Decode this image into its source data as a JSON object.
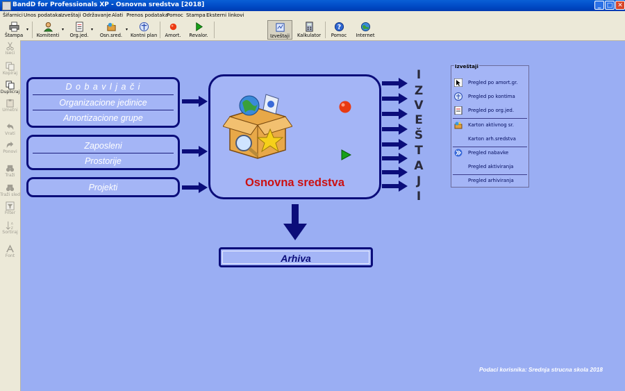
{
  "window": {
    "title": "BandD for Professionals XP - Osnovna sredstva [2018]"
  },
  "menu": [
    "Šifarnici",
    "Unos podataka",
    "Izveštaji",
    "Održavanje",
    "Alati",
    "Prenos podataka",
    "Pomoc",
    "Stampa",
    "Eksterni linkovi"
  ],
  "toolbar": {
    "stampa": "Štampa",
    "komitenti": "Komitenti",
    "orgjed": "Org.jed.",
    "osnsred": "Osn.sred.",
    "kontniplan": "Kontni plan",
    "amort": "Amort.",
    "revalor": "Revalor.",
    "izvestaji": "Izveštaji",
    "kalkulator": "Kalkulator",
    "pomoc": "Pomoc",
    "internet": "Internet"
  },
  "lefttools": [
    "Iseci",
    "Kopiraj",
    "Duplicraj",
    "Umetni",
    "Vrati",
    "Ponovi",
    "Traži",
    "Traži sled",
    "Filter",
    "Sortiraj",
    "Font"
  ],
  "diagram": {
    "group1": [
      "D o b a v l j a č i",
      "Organizacione jedinice",
      "Amortizacione grupe"
    ],
    "group2": [
      "Zaposleni",
      "Prostorije"
    ],
    "group3": [
      "Projekti"
    ],
    "center": "Osnovna sredstva",
    "archive": "Arhiva",
    "reports_letters": [
      "I",
      "Z",
      "V",
      "E",
      "Š",
      "T",
      "A",
      "J",
      "I"
    ]
  },
  "reports_panel": {
    "title": "Izveštaji",
    "items": [
      "Pregled po amort.gr.",
      "Pregled po kontima",
      "Pregled po org.jed.",
      "Karton aktivnog sr.",
      "Karton arh.sredstva",
      "Pregled nabavke",
      "Pregled aktiviranja",
      "Pregled arhiviranja"
    ]
  },
  "footer": "Podaci korisnika: Srednja strucna skola 2018",
  "colors": {
    "desktop": "#9aaef3",
    "box_border": "#0b0d7a",
    "center_title": "#cc1010"
  }
}
